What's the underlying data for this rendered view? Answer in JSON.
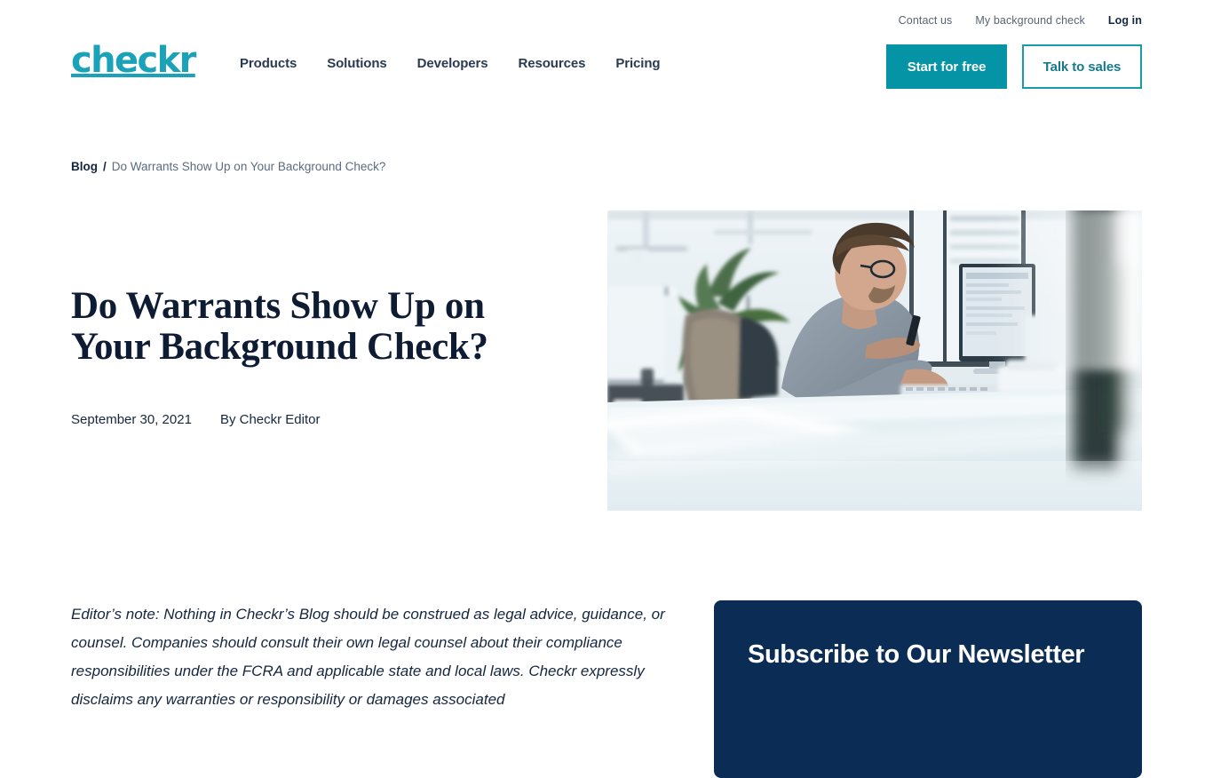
{
  "brand": {
    "logo_text": "checkr",
    "logo_color": "#19A2B8",
    "accent_color": "#0594A6",
    "navy_color": "#0b2d55"
  },
  "header": {
    "utility_links": [
      {
        "label": "Contact us",
        "emphasis": false
      },
      {
        "label": "My background check",
        "emphasis": false
      },
      {
        "label": "Log in",
        "emphasis": true
      }
    ],
    "nav_items": [
      {
        "label": "Products"
      },
      {
        "label": "Solutions"
      },
      {
        "label": "Developers"
      },
      {
        "label": "Resources"
      },
      {
        "label": "Pricing"
      }
    ],
    "cta_primary": "Start for free",
    "cta_secondary": "Talk to sales"
  },
  "breadcrumb": {
    "root": "Blog",
    "separator": "/",
    "current": "Do Warrants Show Up on Your Background Check?"
  },
  "article": {
    "title": "Do Warrants Show Up on Your Background Check?",
    "date": "September 30, 2021",
    "byline": "By Checkr Editor",
    "hero_image_alt": "Man in grey shirt working at a desktop computer in a bright modern office",
    "editor_note": "Editor’s note: Nothing in Checkr’s Blog should be construed as legal advice, guidance, or counsel. Companies should consult their own legal counsel about their compliance responsibilities under the FCRA and applicable state and local laws. Checkr expressly disclaims any warranties or responsibility or damages associated"
  },
  "newsletter": {
    "title": "Subscribe to Our Newsletter"
  }
}
